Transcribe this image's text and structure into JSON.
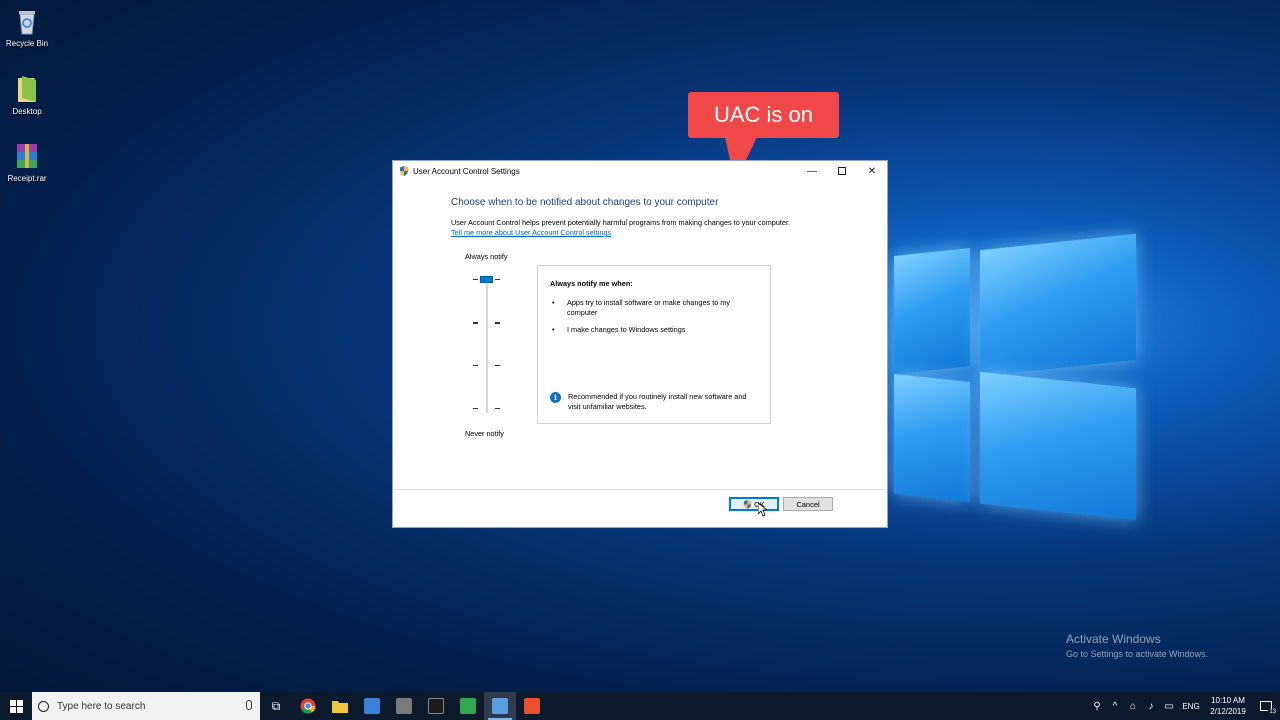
{
  "desktop": {
    "icons": [
      {
        "label": "Recycle Bin"
      },
      {
        "label": "Desktop"
      },
      {
        "label": "Receipt.rar"
      }
    ]
  },
  "callout": {
    "text": "UAC is on"
  },
  "dialog": {
    "title": "User Account Control Settings",
    "heading": "Choose when to be notified about changes to your computer",
    "description": "User Account Control helps prevent potentially harmful programs from making changes to your computer.",
    "link": "Tell me more about User Account Control settings",
    "slider": {
      "top_label": "Always notify",
      "bottom_label": "Never notify",
      "level": 4,
      "levels": 4
    },
    "info": {
      "title": "Always notify me when:",
      "bullets": [
        "Apps try to install software or make changes to my computer",
        "I make changes to Windows settings"
      ],
      "recommendation": "Recommended if you routinely install new software and visit unfamiliar websites."
    },
    "buttons": {
      "ok": "OK",
      "cancel": "Cancel"
    }
  },
  "watermark": {
    "line1": "Activate Windows",
    "line2": "Go to Settings to activate Windows."
  },
  "taskbar": {
    "search_placeholder": "Type here to search",
    "language": "ENG",
    "time": "10:10 AM",
    "date": "2/12/2019",
    "notification_count": "13"
  },
  "colors": {
    "accent": "#0078d7",
    "callout": "#f04848",
    "link": "#0066cc",
    "heading": "#1f3e7d"
  }
}
